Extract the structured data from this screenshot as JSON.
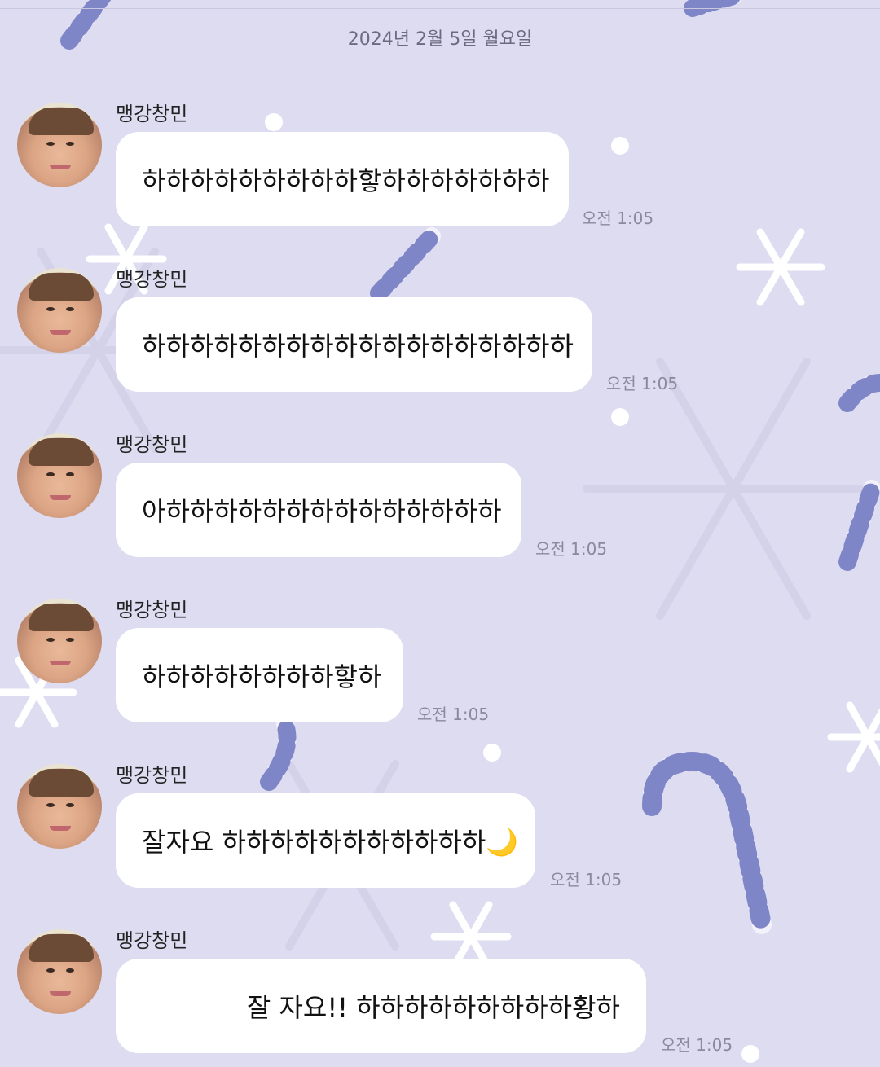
{
  "chat": {
    "date": "2024년 2월 5일 월요일",
    "messages": [
      {
        "sender": "맹강창민",
        "text": "하하하하하하하하하핳하하하하하하하",
        "time": "오전 1:05"
      },
      {
        "sender": "맹강창민",
        "text": "하하하하하하하하하하하하하하하하하하",
        "time": "오전 1:05"
      },
      {
        "sender": "맹강창민",
        "text": "아하하하하하하하하하하하하하하",
        "time": "오전 1:05"
      },
      {
        "sender": "맹강창민",
        "text": "하하하하하하하하핳하",
        "time": "오전 1:05"
      },
      {
        "sender": "맹강창민",
        "text": "잘자요 하하하하하하하하하하하🌙",
        "time": "오전 1:05"
      },
      {
        "sender": "맹강창민",
        "text": "잘 자요!! 하하하하하하하하하황하",
        "time": "오전 1:05"
      }
    ]
  },
  "theme": {
    "background": "#dedcf0",
    "bubble": "#ffffff",
    "candy_cane_stripe": "#7f86c7",
    "snowflake": "#ffffff"
  }
}
